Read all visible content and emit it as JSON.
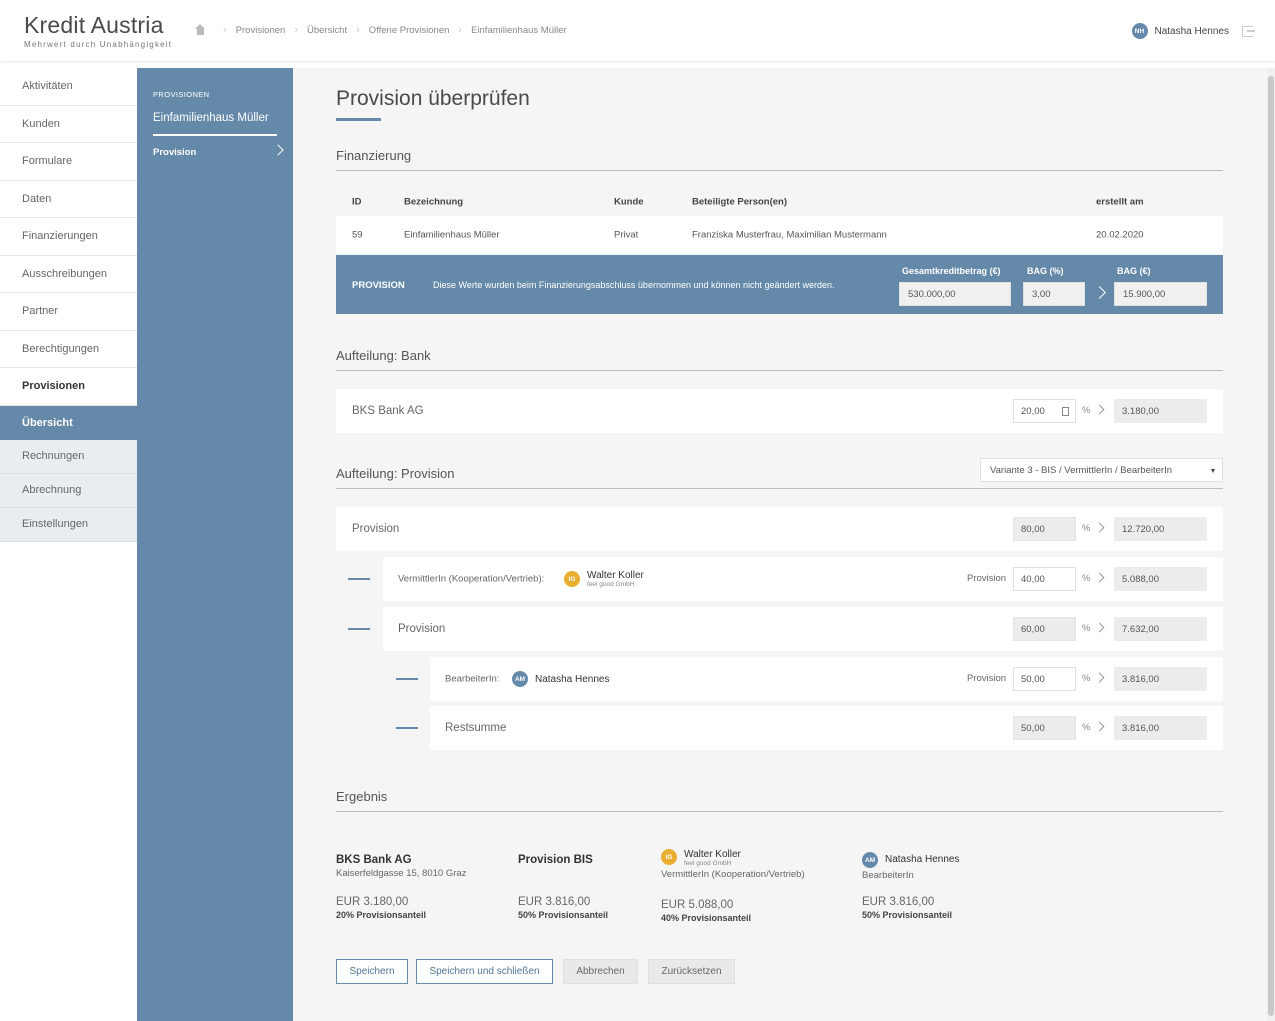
{
  "header": {
    "brand": "Kredit Austria",
    "tagline": "Mehrwert durch Unabhängigkeit",
    "breadcrumbs": [
      "Provisionen",
      "Übersicht",
      "Offene Provisionen",
      "Einfamilienhaus Müller"
    ],
    "user": {
      "initials": "NH",
      "name": "Natasha Hennes"
    }
  },
  "nav": {
    "items": [
      "Aktivitäten",
      "Kunden",
      "Formulare",
      "Daten",
      "Finanzierungen",
      "Ausschreibungen",
      "Partner",
      "Berechtigungen",
      "Provisionen"
    ],
    "active": "Übersicht",
    "subitems": [
      "Rechnungen",
      "Abrechnung",
      "Einstellungen"
    ]
  },
  "sidebar": {
    "caption": "PROVISIONEN",
    "title": "Einfamilienhaus Müller",
    "link": "Provision"
  },
  "page": {
    "title": "Provision überprüfen"
  },
  "finanzierung": {
    "title": "Finanzierung",
    "headers": [
      "ID",
      "Bezeichnung",
      "Kunde",
      "Beteiligte Person(en)",
      "erstellt am"
    ],
    "row": [
      "59",
      "Einfamilienhaus Müller",
      "Privat",
      "Franziska Musterfrau, Maximilian Mustermann",
      "20.02.2020"
    ]
  },
  "provision_bar": {
    "label": "PROVISION",
    "message": "Diese Werte wurden beim Finanzierungsabschluss übernommen und können nicht geändert werden.",
    "gesamt_label": "Gesamtkreditbetrag (€)",
    "gesamt_value": "530.000,00",
    "bag_pct_label": "BAG (%)",
    "bag_pct_value": "3,00",
    "bag_eur_label": "BAG (€)",
    "bag_eur_value": "15.900,00"
  },
  "bank": {
    "title": "Aufteilung: Bank",
    "name": "BKS Bank AG",
    "pct": "20,00",
    "amount": "3.180,00"
  },
  "aufteilung": {
    "title": "Aufteilung: Provision",
    "variant": "Variante 3 - BIS / VermittlerIn / BearbeiterIn",
    "pct_sign": "%",
    "provision_word": "Provision",
    "rows": {
      "provision": {
        "label": "Provision",
        "pct": "80,00",
        "amount": "12.720,00"
      },
      "vermittler": {
        "label": "VermittlerIn (Kooperation/Vertrieb):",
        "initials": "IG",
        "person": "Walter Koller",
        "company": "feel good GmbH",
        "pct": "40,00",
        "amount": "5.088,00"
      },
      "provision2": {
        "label": "Provision",
        "pct": "60,00",
        "amount": "7.632,00"
      },
      "bearbeiter": {
        "label": "BearbeiterIn:",
        "initials": "AM",
        "person": "Natasha Hennes",
        "pct": "50,00",
        "amount": "3.816,00"
      },
      "rest": {
        "label": "Restsumme",
        "pct": "50,00",
        "amount": "3.816,00"
      }
    }
  },
  "ergebnis": {
    "title": "Ergebnis",
    "bank": {
      "name": "BKS Bank AG",
      "address": "Kaiserfeldgasse 15, 8010 Graz",
      "amount": "EUR 3.180,00",
      "share": "20% Provisionsanteil"
    },
    "bis": {
      "name": "Provision BIS",
      "amount": "EUR 3.816,00",
      "share": "50% Provisionsanteil"
    },
    "vermittler": {
      "initials": "IG",
      "name": "Walter Koller",
      "company": "feel good GmbH",
      "role": "VermittlerIn (Kooperation/Vertrieb)",
      "amount": "EUR 5.088,00",
      "share": "40% Provisionsanteil"
    },
    "bearbeiter": {
      "initials": "AM",
      "name": "Natasha Hennes",
      "role": "BearbeiterIn",
      "amount": "EUR 3.816,00",
      "share": "50% Provisionsanteil"
    }
  },
  "buttons": {
    "save": "Speichern",
    "save_close": "Speichern und schließen",
    "cancel": "Abbrechen",
    "reset": "Zurücksetzen"
  },
  "colors": {
    "accent": "#6589a9",
    "gold": "#e9ae2f",
    "background": "#f5f5f5"
  }
}
